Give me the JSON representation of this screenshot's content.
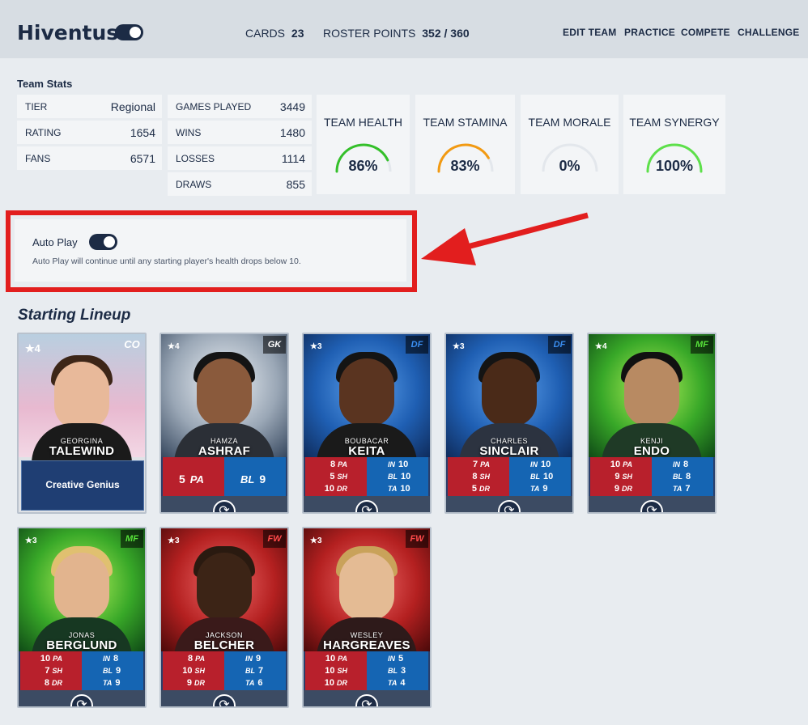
{
  "header": {
    "brand": "Hiventus",
    "cards_label": "CARDS",
    "cards_value": "23",
    "roster_label": "ROSTER POINTS",
    "roster_value": "352 / 360",
    "nav": [
      "EDIT TEAM",
      "PRACTICE",
      "COMPETE",
      "CHALLENGE"
    ]
  },
  "team_stats": {
    "title": "Team Stats",
    "col1": [
      {
        "k": "TIER",
        "v": "Regional"
      },
      {
        "k": "RATING",
        "v": "1654"
      },
      {
        "k": "FANS",
        "v": "6571"
      }
    ],
    "col2": [
      {
        "k": "GAMES PLAYED",
        "v": "3449"
      },
      {
        "k": "WINS",
        "v": "1480"
      },
      {
        "k": "LOSSES",
        "v": "1114"
      },
      {
        "k": "DRAWS",
        "v": "855"
      }
    ],
    "gauges": [
      {
        "label": "TEAM HEALTH",
        "value": "86%",
        "fraction": 0.86,
        "color": "#34c02a"
      },
      {
        "label": "TEAM STAMINA",
        "value": "83%",
        "fraction": 0.83,
        "color": "#f29a12"
      },
      {
        "label": "TEAM MORALE",
        "value": "0%",
        "fraction": 0,
        "color": "#9aa3ad"
      },
      {
        "label": "TEAM SYNERGY",
        "value": "100%",
        "fraction": 1.0,
        "color": "#5de04a"
      }
    ]
  },
  "auto_play": {
    "label": "Auto Play",
    "description": "Auto Play will continue until any starting player's health drops below 10."
  },
  "lineup": {
    "title": "Starting Lineup",
    "coach": {
      "stars": "★4",
      "pos": "CO",
      "first": "GEORGINA",
      "last": "TALEWIND",
      "ability": "Creative Genius"
    },
    "keeper": {
      "stars": "★4",
      "pos": "GK",
      "first": "HAMZA",
      "last": "ASHRAF",
      "pa": "5",
      "pa_label": "PA",
      "bl": "9",
      "bl_label": "BL"
    },
    "players": [
      {
        "stars": "★3",
        "pos": "DF",
        "first": "BOUBACAR",
        "last": "KEITA",
        "pa": "8",
        "sh": "5",
        "dr": "10",
        "in": "10",
        "bl": "10",
        "ta": "10"
      },
      {
        "stars": "★3",
        "pos": "DF",
        "first": "CHARLES",
        "last": "SINCLAIR",
        "pa": "7",
        "sh": "8",
        "dr": "5",
        "in": "10",
        "bl": "10",
        "ta": "9"
      },
      {
        "stars": "★4",
        "pos": "MF",
        "first": "KENJI",
        "last": "ENDO",
        "pa": "10",
        "sh": "9",
        "dr": "9",
        "in": "8",
        "bl": "8",
        "ta": "7"
      },
      {
        "stars": "★3",
        "pos": "MF",
        "first": "JONAS",
        "last": "BERGLUND",
        "pa": "10",
        "sh": "7",
        "dr": "8",
        "in": "8",
        "bl": "9",
        "ta": "9"
      },
      {
        "stars": "★3",
        "pos": "FW",
        "first": "JACKSON",
        "last": "BELCHER",
        "pa": "8",
        "sh": "10",
        "dr": "9",
        "in": "9",
        "bl": "7",
        "ta": "6"
      },
      {
        "stars": "★3",
        "pos": "FW",
        "first": "WESLEY",
        "last": "HARGREAVES",
        "pa": "10",
        "sh": "10",
        "dr": "10",
        "in": "5",
        "bl": "3",
        "ta": "4"
      }
    ],
    "stat_labels": {
      "pa": "PA",
      "sh": "SH",
      "dr": "DR",
      "in": "IN",
      "bl": "BL",
      "ta": "TA"
    }
  },
  "colors": {
    "navy": "#1c2b45",
    "highlight_red": "#e21e1e",
    "stat_red": "#b8202c",
    "stat_blue": "#1565b3"
  }
}
